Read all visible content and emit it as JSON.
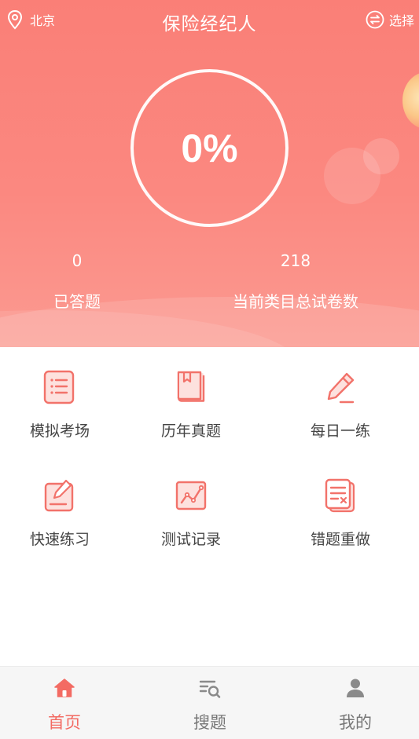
{
  "header": {
    "location": "北京",
    "title": "保险经纪人",
    "switch_label": "选择"
  },
  "progress": {
    "percent_text": "0%",
    "value": 0
  },
  "stats": {
    "answered_count": "0",
    "answered_label": "已答题",
    "total_papers": "218",
    "total_label": "当前类目总试卷数"
  },
  "features": [
    {
      "label": "模拟考场",
      "icon": "exam-list-icon"
    },
    {
      "label": "历年真题",
      "icon": "book-icon"
    },
    {
      "label": "每日一练",
      "icon": "pencil-icon"
    },
    {
      "label": "快速练习",
      "icon": "edit-note-icon"
    },
    {
      "label": "测试记录",
      "icon": "chart-line-icon"
    },
    {
      "label": "错题重做",
      "icon": "wrong-doc-icon"
    }
  ],
  "bottom_nav": [
    {
      "label": "首页",
      "icon": "home-icon",
      "active": true
    },
    {
      "label": "搜题",
      "icon": "search-list-icon",
      "active": false
    },
    {
      "label": "我的",
      "icon": "user-icon",
      "active": false
    }
  ],
  "colors": {
    "brand": "#fa7f77",
    "icon": "#f2726a",
    "active": "#f36b63",
    "inactive": "#777777"
  }
}
